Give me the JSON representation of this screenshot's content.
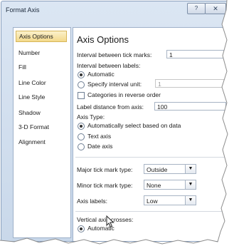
{
  "window": {
    "title": "Format Axis",
    "help_glyph": "?",
    "close_glyph": "✕"
  },
  "nav": {
    "items": [
      {
        "label": "Axis Options",
        "selected": true
      },
      {
        "label": "Number"
      },
      {
        "label": "Fill"
      },
      {
        "label": "Line Color"
      },
      {
        "label": "Line Style"
      },
      {
        "label": "Shadow"
      },
      {
        "label": "3-D Format"
      },
      {
        "label": "Alignment"
      }
    ]
  },
  "panel": {
    "heading": "Axis Options",
    "interval_ticks_label": "Interval between tick marks:",
    "interval_ticks_value": "1",
    "interval_labels_label": "Interval between labels:",
    "automatic_label": "Automatic",
    "specify_interval_label": "Specify interval unit:",
    "specify_interval_value": "1",
    "reverse_order_label": "Categories in reverse order",
    "label_distance_label": "Label distance from axis:",
    "label_distance_value": "100",
    "axis_type_label": "Axis Type:",
    "axis_type_auto": "Automatically select based on data",
    "axis_type_text": "Text axis",
    "axis_type_date": "Date axis",
    "major_tick_label": "Major tick mark type:",
    "major_tick_value": "Outside",
    "minor_tick_label": "Minor tick mark type:",
    "minor_tick_value": "None",
    "axis_labels_label": "Axis labels:",
    "axis_labels_value": "Low",
    "vertical_crosses_label": "Vertical axis crosses:",
    "vertical_crosses_auto": "Automatic",
    "dropdown_glyph": "▼"
  },
  "colors": {
    "frame": "#c9d8ea",
    "selected_nav": "#f3d98b"
  }
}
